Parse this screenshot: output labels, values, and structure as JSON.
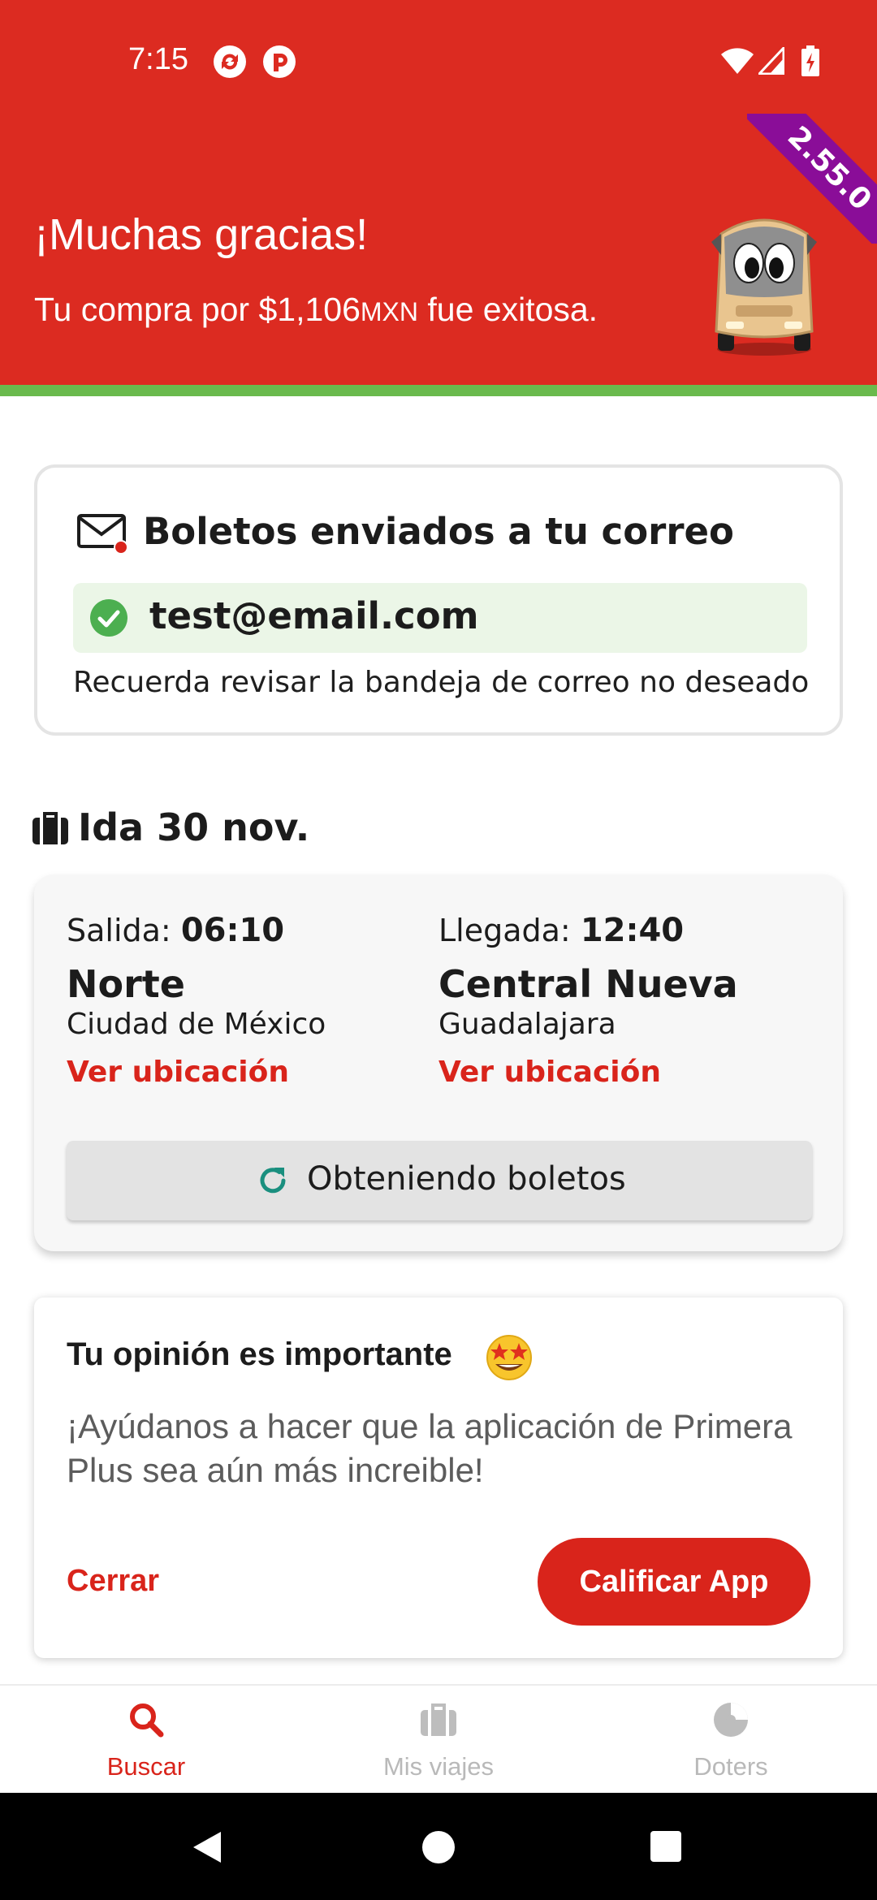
{
  "status_bar": {
    "time": "7:15",
    "icons": [
      "sync-app-icon",
      "app-notification-icon",
      "wifi-icon",
      "signal-icon",
      "battery-charging-icon"
    ]
  },
  "header": {
    "version": "2.55.0",
    "title": "¡Muchas gracias!",
    "subtitle_prefix": "Tu compra por $1,106",
    "subtitle_currency": "MXN",
    "subtitle_suffix": " fue exitosa.",
    "background_color": "#dc2b21",
    "accent_stripe_color": "#6aba4d",
    "ribbon_color": "#8a0d98"
  },
  "email_card": {
    "title": "Boletos enviados a tu correo",
    "email": "test@email.com",
    "hint": "Recuerda revisar la bandeja de correo no deseado"
  },
  "trip": {
    "heading": "Ida 30 nov.",
    "departure": {
      "label": "Salida: ",
      "time": "06:10",
      "terminal": "Norte",
      "city": "Ciudad de México",
      "link": "Ver ubicación"
    },
    "arrival": {
      "label": "Llegada: ",
      "time": "12:40",
      "terminal": "Central Nueva",
      "city": "Guadalajara",
      "link": "Ver ubicación"
    },
    "tickets_button": "Obteniendo boletos"
  },
  "opinion_card": {
    "title": "Tu opinión es importante",
    "body": "¡Ayúdanos a hacer que la aplicación de Primera Plus sea aún más increible!",
    "close_label": "Cerrar",
    "rate_label": "Calificar App"
  },
  "bottom_nav": {
    "items": [
      {
        "label": "Buscar",
        "icon": "search-icon",
        "active": true
      },
      {
        "label": "Mis viajes",
        "icon": "luggage-icon",
        "active": false
      },
      {
        "label": "Doters",
        "icon": "doters-icon",
        "active": false
      }
    ]
  },
  "colors": {
    "brand_red": "#d9241b",
    "success_green": "#4caf50",
    "refresh_teal": "#1a8f7f"
  }
}
